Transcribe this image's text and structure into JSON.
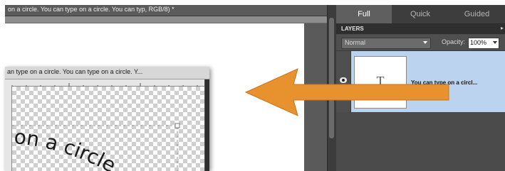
{
  "document": {
    "tab_title": "on a circle. You can type on a circle. You can typ, RGB/8) *"
  },
  "floating_window": {
    "title": "an type on a circle. You can type on a circle. Y..."
  },
  "canvas": {
    "curved_text": "on a circle"
  },
  "panel": {
    "modes": {
      "full": "Full",
      "quick": "Quick",
      "guided": "Guided"
    },
    "header": "LAYERS",
    "options_glyph": "▸",
    "blend_mode": "Normal",
    "opacity_label": "Opacity:",
    "opacity_value": "100%",
    "layer": {
      "thumb_letter": "T",
      "name": "You can type on a circl..."
    }
  },
  "colors": {
    "arrow": "#e8922f",
    "selected_layer": "#bcd3ef"
  }
}
